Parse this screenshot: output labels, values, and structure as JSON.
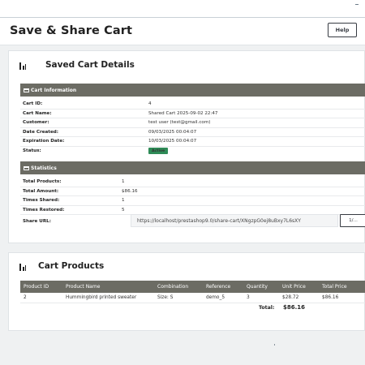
{
  "header": {
    "title": "Save & Share Cart",
    "help_label": "Help"
  },
  "details_card": {
    "title": "Saved Cart Details",
    "icon": "bar-chart-icon",
    "cart_info": {
      "heading": "Cart Information",
      "rows": [
        {
          "label": "Cart ID:",
          "value": "4"
        },
        {
          "label": "Cart Name:",
          "value": "Shared Cart 2025-09-02 22:47"
        },
        {
          "label": "Customer:",
          "value": "test user (test@gmail.com)"
        },
        {
          "label": "Date Created:",
          "value": "09/03/2025 00:04:07"
        },
        {
          "label": "Expiration Date:",
          "value": "10/03/2025 00:04:07"
        },
        {
          "label": "Status:",
          "value": "Active"
        }
      ]
    },
    "statistics": {
      "heading": "Statistics",
      "rows": [
        {
          "label": "Total Products:",
          "value": "1"
        },
        {
          "label": "Total Amount:",
          "value": "$86.16"
        },
        {
          "label": "Times Shared:",
          "value": "1"
        },
        {
          "label": "Times Restored:",
          "value": "5"
        }
      ],
      "share_url_label": "Share URL:",
      "share_url": "https://localhost/prestashop9.0/share-cart/XNgzpG0ej8uBxy7L6sXY",
      "copy_label": "1/..."
    }
  },
  "products_card": {
    "title": "Cart Products",
    "icon": "bar-chart-icon",
    "columns": [
      "Product ID",
      "Product Name",
      "Combination",
      "Reference",
      "Quantity",
      "Unit Price",
      "Total Price"
    ],
    "rows": [
      [
        "2",
        "Hummingbird printed sweater",
        "Size: S",
        "demo_5",
        "3",
        "$28.72",
        "$86.16"
      ]
    ],
    "total_label": "Total:",
    "total_value": "$86.16"
  },
  "colors": {
    "section_header": "#6c6c64",
    "status_active": "#2e8b57",
    "background": "#eff1f2"
  }
}
